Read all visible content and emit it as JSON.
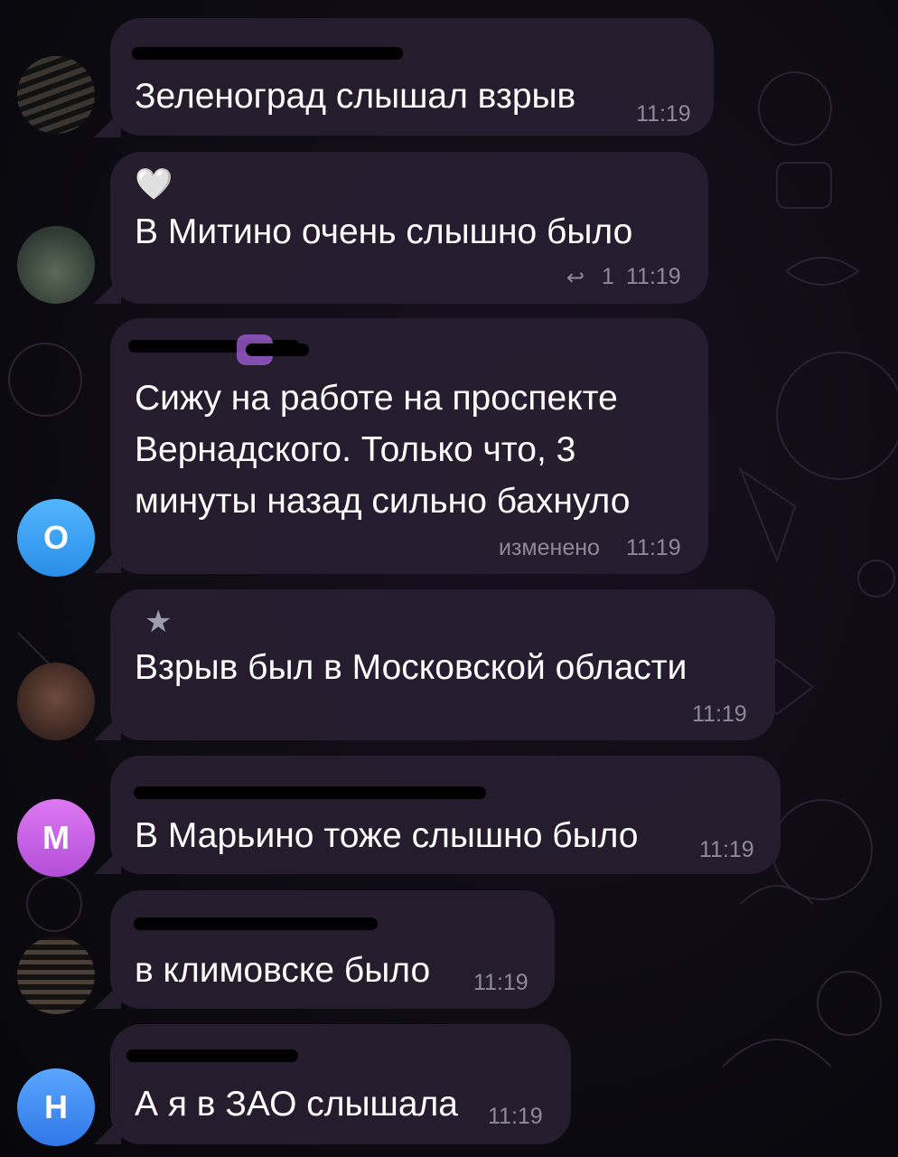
{
  "messages": [
    {
      "sender_visible": "v",
      "text": "Зеленоград слышал взрыв",
      "time": "11:19"
    },
    {
      "reaction": "🤍",
      "text": "В Митино очень слышно было",
      "reply_count": "1",
      "time": "11:19"
    },
    {
      "lines": [
        "Сижу на работе на проспекте",
        "Вернадского. Только что, 3",
        "минуты назад сильно бахнуло"
      ],
      "edited_label": "изменено",
      "time": "11:19"
    },
    {
      "text": "Взрыв был в Московской области",
      "time": "11:19"
    },
    {
      "text": "В Марьино тоже слышно было",
      "time": "11:19"
    },
    {
      "text": "в климовске было",
      "time": "11:19"
    },
    {
      "text": "А я в ЗАО слышала",
      "time": "11:19"
    }
  ],
  "avatars": {
    "o": "О",
    "m": "М",
    "n": "Н"
  },
  "colors": {
    "bubble": "#261e30",
    "avatar_o": "#3aa0f0",
    "avatar_m": "#c15ee3",
    "avatar_n": "#3f8cf0",
    "time": "#8e8a9a"
  }
}
